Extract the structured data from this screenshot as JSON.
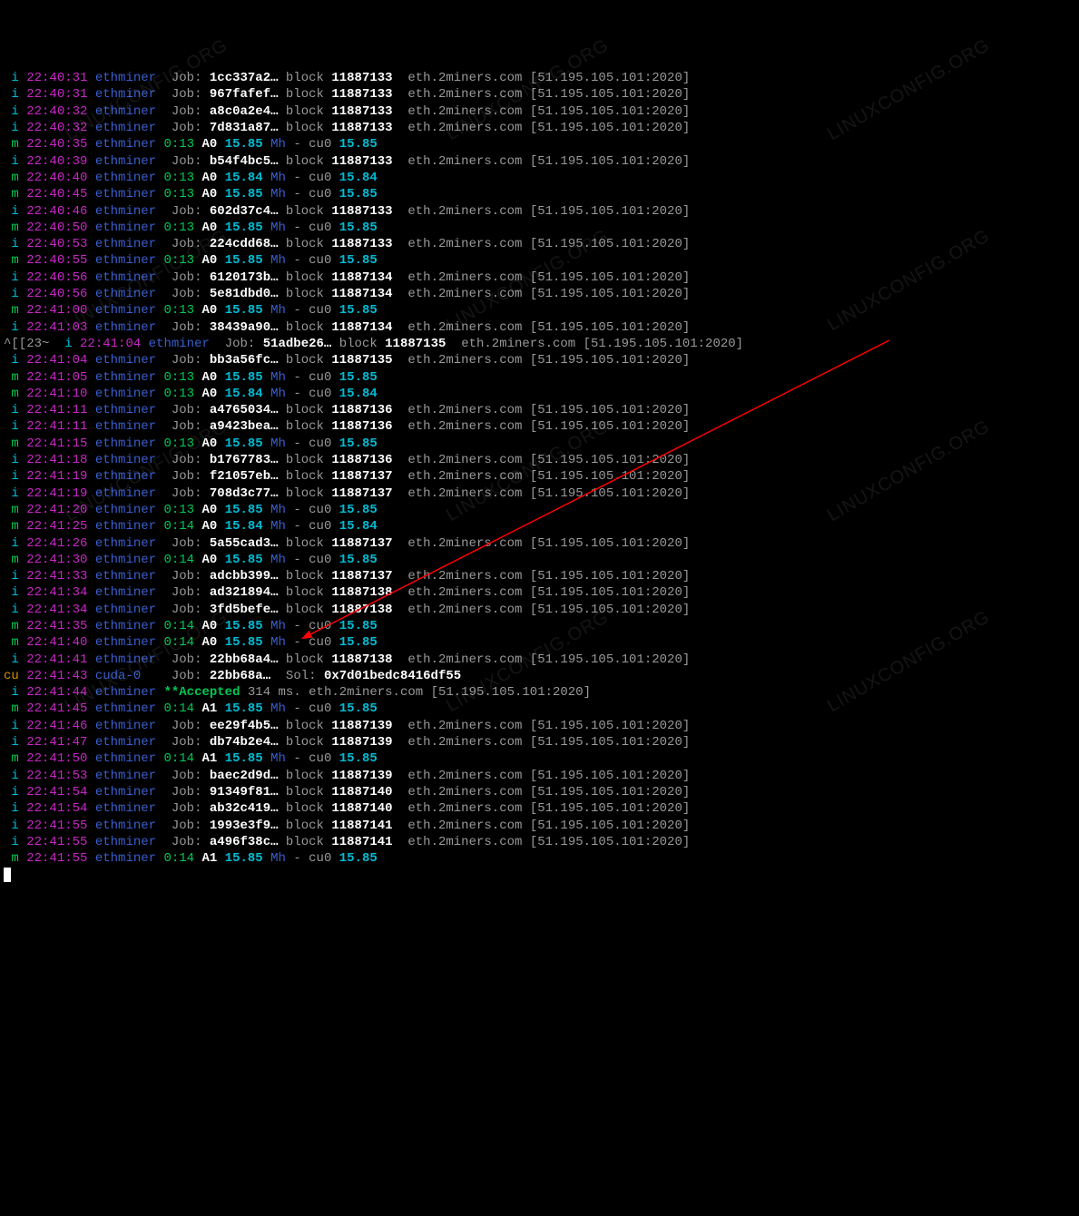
{
  "watermark_text": "LINUXCONFIG.ORG",
  "pool": "eth.2miners.com",
  "endpoint": "[51.195.105.101:2020]",
  "lines": [
    {
      "t": "i",
      "time": "22:40:31",
      "proc": "ethminer",
      "kind": "job",
      "hash": "1cc337a2…",
      "block": "11887133"
    },
    {
      "t": "i",
      "time": "22:40:31",
      "proc": "ethminer",
      "kind": "job",
      "hash": "967fafef…",
      "block": "11887133"
    },
    {
      "t": "i",
      "time": "22:40:32",
      "proc": "ethminer",
      "kind": "job",
      "hash": "a8c0a2e4…",
      "block": "11887133"
    },
    {
      "t": "i",
      "time": "22:40:32",
      "proc": "ethminer",
      "kind": "job",
      "hash": "7d831a87…",
      "block": "11887133"
    },
    {
      "t": "m",
      "time": "22:40:35",
      "proc": "ethminer",
      "kind": "stat",
      "el": "0:13",
      "a": "A0",
      "hr": "15.85",
      "cu": "15.85"
    },
    {
      "t": "i",
      "time": "22:40:39",
      "proc": "ethminer",
      "kind": "job",
      "hash": "b54f4bc5…",
      "block": "11887133"
    },
    {
      "t": "m",
      "time": "22:40:40",
      "proc": "ethminer",
      "kind": "stat",
      "el": "0:13",
      "a": "A0",
      "hr": "15.84",
      "cu": "15.84"
    },
    {
      "t": "m",
      "time": "22:40:45",
      "proc": "ethminer",
      "kind": "stat",
      "el": "0:13",
      "a": "A0",
      "hr": "15.85",
      "cu": "15.85"
    },
    {
      "t": "i",
      "time": "22:40:46",
      "proc": "ethminer",
      "kind": "job",
      "hash": "602d37c4…",
      "block": "11887133"
    },
    {
      "t": "m",
      "time": "22:40:50",
      "proc": "ethminer",
      "kind": "stat",
      "el": "0:13",
      "a": "A0",
      "hr": "15.85",
      "cu": "15.85"
    },
    {
      "t": "i",
      "time": "22:40:53",
      "proc": "ethminer",
      "kind": "job",
      "hash": "224cdd68…",
      "block": "11887133"
    },
    {
      "t": "m",
      "time": "22:40:55",
      "proc": "ethminer",
      "kind": "stat",
      "el": "0:13",
      "a": "A0",
      "hr": "15.85",
      "cu": "15.85"
    },
    {
      "t": "i",
      "time": "22:40:56",
      "proc": "ethminer",
      "kind": "job",
      "hash": "6120173b…",
      "block": "11887134"
    },
    {
      "t": "i",
      "time": "22:40:56",
      "proc": "ethminer",
      "kind": "job",
      "hash": "5e81dbd0…",
      "block": "11887134"
    },
    {
      "t": "m",
      "time": "22:41:00",
      "proc": "ethminer",
      "kind": "stat",
      "el": "0:13",
      "a": "A0",
      "hr": "15.85",
      "cu": "15.85"
    },
    {
      "t": "i",
      "time": "22:41:03",
      "proc": "ethminer",
      "kind": "job",
      "hash": "38439a90…",
      "block": "11887134"
    },
    {
      "t": "i",
      "time": "22:41:04",
      "proc": "ethminer",
      "kind": "job",
      "hash": "51adbe26…",
      "block": "11887135",
      "prefix": "^[[23~ "
    },
    {
      "t": "i",
      "time": "22:41:04",
      "proc": "ethminer",
      "kind": "job",
      "hash": "bb3a56fc…",
      "block": "11887135"
    },
    {
      "t": "m",
      "time": "22:41:05",
      "proc": "ethminer",
      "kind": "stat",
      "el": "0:13",
      "a": "A0",
      "hr": "15.85",
      "cu": "15.85"
    },
    {
      "t": "m",
      "time": "22:41:10",
      "proc": "ethminer",
      "kind": "stat",
      "el": "0:13",
      "a": "A0",
      "hr": "15.84",
      "cu": "15.84"
    },
    {
      "t": "i",
      "time": "22:41:11",
      "proc": "ethminer",
      "kind": "job",
      "hash": "a4765034…",
      "block": "11887136"
    },
    {
      "t": "i",
      "time": "22:41:11",
      "proc": "ethminer",
      "kind": "job",
      "hash": "a9423bea…",
      "block": "11887136"
    },
    {
      "t": "m",
      "time": "22:41:15",
      "proc": "ethminer",
      "kind": "stat",
      "el": "0:13",
      "a": "A0",
      "hr": "15.85",
      "cu": "15.85"
    },
    {
      "t": "i",
      "time": "22:41:18",
      "proc": "ethminer",
      "kind": "job",
      "hash": "b1767783…",
      "block": "11887136"
    },
    {
      "t": "i",
      "time": "22:41:19",
      "proc": "ethminer",
      "kind": "job",
      "hash": "f21057eb…",
      "block": "11887137"
    },
    {
      "t": "i",
      "time": "22:41:19",
      "proc": "ethminer",
      "kind": "job",
      "hash": "708d3c77…",
      "block": "11887137"
    },
    {
      "t": "m",
      "time": "22:41:20",
      "proc": "ethminer",
      "kind": "stat",
      "el": "0:13",
      "a": "A0",
      "hr": "15.85",
      "cu": "15.85"
    },
    {
      "t": "m",
      "time": "22:41:25",
      "proc": "ethminer",
      "kind": "stat",
      "el": "0:14",
      "a": "A0",
      "hr": "15.84",
      "cu": "15.84"
    },
    {
      "t": "i",
      "time": "22:41:26",
      "proc": "ethminer",
      "kind": "job",
      "hash": "5a55cad3…",
      "block": "11887137"
    },
    {
      "t": "m",
      "time": "22:41:30",
      "proc": "ethminer",
      "kind": "stat",
      "el": "0:14",
      "a": "A0",
      "hr": "15.85",
      "cu": "15.85"
    },
    {
      "t": "i",
      "time": "22:41:33",
      "proc": "ethminer",
      "kind": "job",
      "hash": "adcbb399…",
      "block": "11887137"
    },
    {
      "t": "i",
      "time": "22:41:34",
      "proc": "ethminer",
      "kind": "job",
      "hash": "ad321894…",
      "block": "11887138"
    },
    {
      "t": "i",
      "time": "22:41:34",
      "proc": "ethminer",
      "kind": "job",
      "hash": "3fd5befe…",
      "block": "11887138"
    },
    {
      "t": "m",
      "time": "22:41:35",
      "proc": "ethminer",
      "kind": "stat",
      "el": "0:14",
      "a": "A0",
      "hr": "15.85",
      "cu": "15.85"
    },
    {
      "t": "m",
      "time": "22:41:40",
      "proc": "ethminer",
      "kind": "stat",
      "el": "0:14",
      "a": "A0",
      "hr": "15.85",
      "cu": "15.85"
    },
    {
      "t": "i",
      "time": "22:41:41",
      "proc": "ethminer",
      "kind": "job",
      "hash": "22bb68a4…",
      "block": "11887138"
    },
    {
      "t": "cu",
      "time": "22:41:43",
      "proc": "cuda-0",
      "kind": "sol",
      "hash": "22bb68a…",
      "sol": "0x7d01bedc8416df55"
    },
    {
      "t": "i",
      "time": "22:41:44",
      "proc": "ethminer",
      "kind": "accepted",
      "ms": "314"
    },
    {
      "t": "m",
      "time": "22:41:45",
      "proc": "ethminer",
      "kind": "stat",
      "el": "0:14",
      "a": "A1",
      "hr": "15.85",
      "cu": "15.85"
    },
    {
      "t": "i",
      "time": "22:41:46",
      "proc": "ethminer",
      "kind": "job",
      "hash": "ee29f4b5…",
      "block": "11887139"
    },
    {
      "t": "i",
      "time": "22:41:47",
      "proc": "ethminer",
      "kind": "job",
      "hash": "db74b2e4…",
      "block": "11887139"
    },
    {
      "t": "m",
      "time": "22:41:50",
      "proc": "ethminer",
      "kind": "stat",
      "el": "0:14",
      "a": "A1",
      "hr": "15.85",
      "cu": "15.85"
    },
    {
      "t": "i",
      "time": "22:41:53",
      "proc": "ethminer",
      "kind": "job",
      "hash": "baec2d9d…",
      "block": "11887139"
    },
    {
      "t": "i",
      "time": "22:41:54",
      "proc": "ethminer",
      "kind": "job",
      "hash": "91349f81…",
      "block": "11887140"
    },
    {
      "t": "i",
      "time": "22:41:54",
      "proc": "ethminer",
      "kind": "job",
      "hash": "ab32c419…",
      "block": "11887140"
    },
    {
      "t": "i",
      "time": "22:41:55",
      "proc": "ethminer",
      "kind": "job",
      "hash": "1993e3f9…",
      "block": "11887141"
    },
    {
      "t": "i",
      "time": "22:41:55",
      "proc": "ethminer",
      "kind": "job",
      "hash": "a496f38c…",
      "block": "11887141"
    },
    {
      "t": "m",
      "time": "22:41:55",
      "proc": "ethminer",
      "kind": "stat",
      "el": "0:14",
      "a": "A1",
      "hr": "15.85",
      "cu": "15.85"
    }
  ],
  "labels": {
    "job": "Job:",
    "block": "block",
    "sol": "Sol:",
    "accepted": "**Accepted",
    "ms": "ms.",
    "mh": "Mh",
    "dash": "-",
    "cu0": "cu0"
  }
}
